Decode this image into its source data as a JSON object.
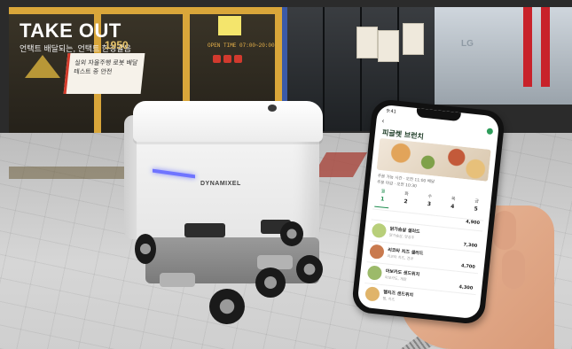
{
  "scene": {
    "store_sign": "TAKE OUT",
    "store_subline": "언택트 배달되는, 언택트 한경갈음",
    "store_number": "1950",
    "promo_text": "실외 자율주행 로봇 배달 테스트 중 안전",
    "open_hours": "OPEN TIME 07:00~20:00",
    "robot_brand": "DYNAMIXEL",
    "other_sign": "LG"
  },
  "phone": {
    "time": "9:41",
    "title": "피글렛 브런치",
    "info_1": "주문 가능 시간 · 오전 11:00 배달",
    "info_2": "주문 마감 · 오전 10:30",
    "tabs": [
      {
        "w": "월",
        "d": "1"
      },
      {
        "w": "화",
        "d": "2"
      },
      {
        "w": "수",
        "d": "3"
      },
      {
        "w": "목",
        "d": "4"
      },
      {
        "w": "금",
        "d": "5"
      }
    ],
    "menu": [
      {
        "name": "",
        "desc": "",
        "price": "4,900"
      },
      {
        "name": "닭가슴살 샐러드",
        "desc": "닭가슴살, 양상추",
        "price": "7,300"
      },
      {
        "name": "리코타 치즈 샐러드",
        "desc": "리코타 치즈, 견과",
        "price": "4,700"
      },
      {
        "name": "아보카도 샌드위치",
        "desc": "아보카도, 계란",
        "price": "4,300"
      },
      {
        "name": "햄치즈 샌드위치",
        "desc": "햄, 치즈",
        "price": ""
      }
    ],
    "colors": {
      "accent": "#1e8c4e",
      "led": "#6f74ff"
    }
  }
}
